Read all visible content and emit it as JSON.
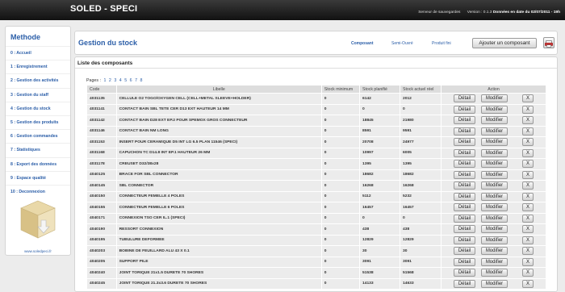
{
  "app": {
    "brand": "SOLED - SPECI",
    "backup_server": "Serveur de sauvegardes",
    "version": "Version : 0.1.3",
    "data_date": "Données en date du 02/07/2011 - 19h"
  },
  "sidebar": {
    "title": "Methode",
    "items": [
      {
        "label": "0 : Accueil"
      },
      {
        "label": "1 : Enregistrement"
      },
      {
        "label": "2 : Gestion des activités"
      },
      {
        "label": "3 : Gestion du staff"
      },
      {
        "label": "4 : Gestion du stock"
      },
      {
        "label": "5 : Gestion des produits"
      },
      {
        "label": "6 : Gestion commandes"
      },
      {
        "label": "7 : Statistiques"
      },
      {
        "label": "8 : Export des données"
      },
      {
        "label": "9 : Espace qualité"
      },
      {
        "label": "10 : Deconnexion"
      }
    ],
    "site": "www.soledpeci.fr"
  },
  "header": {
    "title": "Gestion du stock",
    "tabs": [
      {
        "label": "Composant"
      },
      {
        "label": "Semi-Ouvré"
      },
      {
        "label": "Produit fini"
      }
    ],
    "add_button": "Ajouter un composant",
    "print_icon": "printer-icon"
  },
  "list": {
    "title": "Liste des composants",
    "pages_label": "Pages :",
    "pages": [
      "1",
      "2",
      "3",
      "4",
      "5",
      "6",
      "7",
      "8"
    ],
    "columns": {
      "code": "Code",
      "libelle": "Libelle",
      "stock_min": "Stock minimum",
      "stock_plan": "Stock planifié",
      "stock_reel": "Stock actuel réel",
      "action": "Action"
    },
    "buttons": {
      "detail": "Détail",
      "modify": "Modifier",
      "delete": "X"
    },
    "rows": [
      {
        "code": "4031135",
        "libelle": "CELLULE O2 TOGO/OXYGEN CELL (CELL+METAL SLEEVE+HOLDER)",
        "min": "0",
        "plan": "6142",
        "reel": "2012"
      },
      {
        "code": "4031141",
        "libelle": "CONTACT BAIN SBL TETE CER D13 EXT HAUTEUR 14 MM",
        "min": "0",
        "plan": "0",
        "reel": "0"
      },
      {
        "code": "4031142",
        "libelle": "CONTACT BAIN D28 EXT EP.2 POUR SPEMOX GROS CONNECTEUR",
        "min": "0",
        "plan": "18845",
        "reel": "21980"
      },
      {
        "code": "4031146",
        "libelle": "CONTACT BAIN NM LONG",
        "min": "0",
        "plan": "8591",
        "reel": "9591"
      },
      {
        "code": "4031153",
        "libelle": "INSERT POUR CERAMIQUE D5 INT LG 6.5 PLAN 11546 (SPECI)",
        "min": "0",
        "plan": "20708",
        "reel": "24977"
      },
      {
        "code": "4031168",
        "libelle": "CAPUCHON TC D14.8 INT EP.1 HAUTEUR 26 MM",
        "min": "0",
        "plan": "10997",
        "reel": "6005"
      },
      {
        "code": "4031178",
        "libelle": "CREUSET D32/38x28",
        "min": "0",
        "plan": "1395",
        "reel": "1395"
      },
      {
        "code": "4040125",
        "libelle": "BRACE FOR SBL CONNECTOR",
        "min": "0",
        "plan": "18682",
        "reel": "18682"
      },
      {
        "code": "4040145",
        "libelle": "SBL CONNECTOR",
        "min": "0",
        "plan": "16268",
        "reel": "16268"
      },
      {
        "code": "4040150",
        "libelle": "CONNECTEUR FEMELLE 4 POLES",
        "min": "0",
        "plan": "5112",
        "reel": "5232"
      },
      {
        "code": "4040155",
        "libelle": "CONNECTEUR FEMELLE 6 POLES",
        "min": "0",
        "plan": "16457",
        "reel": "16457"
      },
      {
        "code": "4040171",
        "libelle": "CONNEXION TSO CER IL.1 (SPECI)",
        "min": "0",
        "plan": "0",
        "reel": "0"
      },
      {
        "code": "4040190",
        "libelle": "RESSORT CONNEXION",
        "min": "0",
        "plan": "438",
        "reel": "438"
      },
      {
        "code": "4040195",
        "libelle": "TUBULURE DEFORMEE",
        "min": "0",
        "plan": "12829",
        "reel": "12829"
      },
      {
        "code": "4040203",
        "libelle": "BOBINE DE FEUILLARD ALU 43 X 0.1",
        "min": "0",
        "plan": "30",
        "reel": "30"
      },
      {
        "code": "4040205",
        "libelle": "SUPPORT PILE",
        "min": "0",
        "plan": "3091",
        "reel": "3091"
      },
      {
        "code": "4040240",
        "libelle": "JOINT TORIQUE 21x1.5 DURETE 70 SHORES",
        "min": "0",
        "plan": "51538",
        "reel": "51568"
      },
      {
        "code": "4040245",
        "libelle": "JOINT TORIQUE 21.3x3.6 DURETE 70 SHORES",
        "min": "0",
        "plan": "14133",
        "reel": "14633"
      }
    ]
  }
}
